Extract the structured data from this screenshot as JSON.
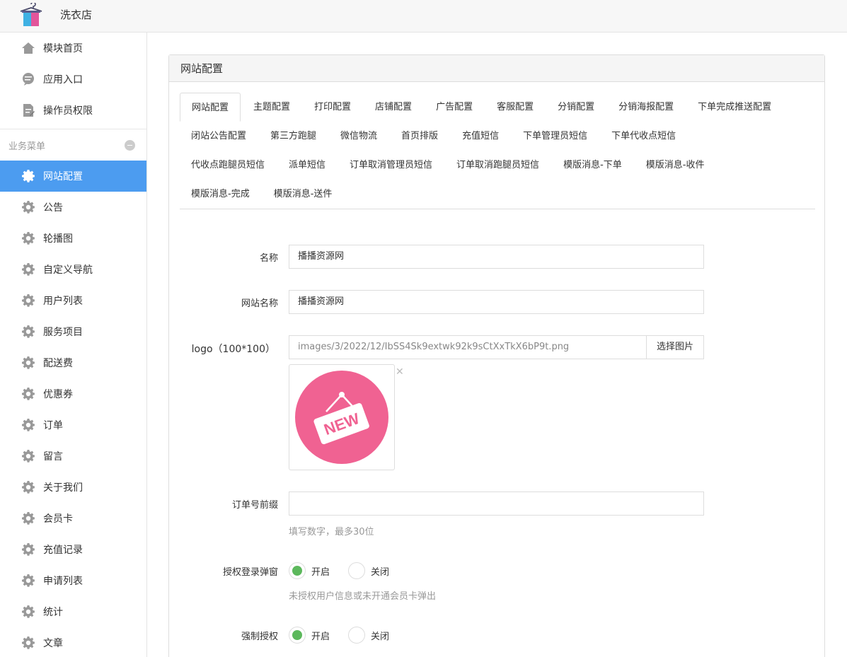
{
  "app": {
    "title": "洗衣店"
  },
  "sidebar": {
    "top_items": [
      {
        "label": "模块首页",
        "icon": "home-icon"
      },
      {
        "label": "应用入口",
        "icon": "chat-icon"
      },
      {
        "label": "操作员权限",
        "icon": "document-icon"
      }
    ],
    "section_title": "业务菜单",
    "items": [
      {
        "label": "网站配置",
        "active": true
      },
      {
        "label": "公告"
      },
      {
        "label": "轮播图"
      },
      {
        "label": "自定义导航"
      },
      {
        "label": "用户列表"
      },
      {
        "label": "服务项目"
      },
      {
        "label": "配送费"
      },
      {
        "label": "优惠券"
      },
      {
        "label": "订单"
      },
      {
        "label": "留言"
      },
      {
        "label": "关于我们"
      },
      {
        "label": "会员卡"
      },
      {
        "label": "充值记录"
      },
      {
        "label": "申请列表"
      },
      {
        "label": "统计"
      },
      {
        "label": "文章"
      }
    ]
  },
  "panel": {
    "title": "网站配置",
    "tabs": [
      [
        "网站配置",
        "主题配置",
        "打印配置",
        "店铺配置",
        "广告配置",
        "客服配置",
        "分销配置",
        "分销海报配置",
        "下单完成推送配置"
      ],
      [
        "闭站公告配置",
        "第三方跑腿",
        "微信物流",
        "首页排版",
        "充值短信",
        "下单管理员短信",
        "下单代收点短信"
      ],
      [
        "代收点跑腿员短信",
        "派单短信",
        "订单取消管理员短信",
        "订单取消跑腿员短信",
        "模版消息-下单",
        "模版消息-收件"
      ],
      [
        "模版消息-完成",
        "模版消息-送件"
      ]
    ]
  },
  "form": {
    "name_label": "名称",
    "name_value": "播播资源网",
    "site_name_label": "网站名称",
    "site_name_value": "播播资源网",
    "logo_label": "logo（100*100）",
    "logo_path": "images/3/2022/12/IbSS4Sk9extwk92k9sCtXxTkX6bP9t.png",
    "logo_button": "选择图片",
    "logo_badge_text": "NEW",
    "order_prefix_label": "订单号前缀",
    "order_prefix_value": "",
    "order_prefix_hint": "填写数字，最多30位",
    "auth_popup_label": "授权登录弹窗",
    "auth_popup_hint": "未授权用户信息或未开通会员卡弹出",
    "force_auth_label": "强制授权",
    "radio_on": "开启",
    "radio_off": "关闭"
  },
  "colors": {
    "accent": "#4c9cf0",
    "radio_on": "#5cb85c",
    "logo_pink": "#f06292"
  }
}
